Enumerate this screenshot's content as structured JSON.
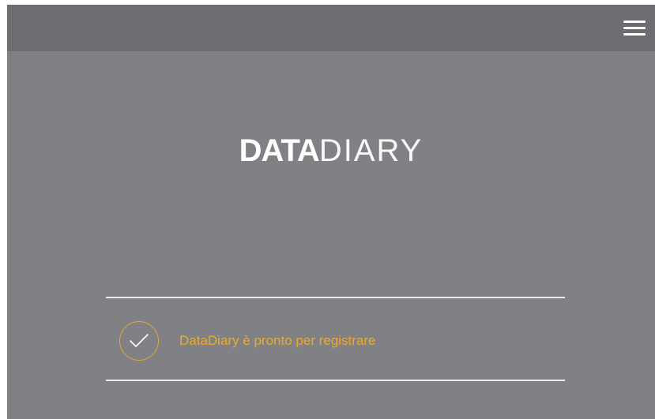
{
  "header": {
    "menu_icon": "hamburger-menu-icon"
  },
  "logo": {
    "bold": "DATA",
    "light": "DIARY"
  },
  "status": {
    "icon": "checkmark-circle-icon",
    "text": "DataDiary è pronto per registrare"
  },
  "colors": {
    "background": "#808184",
    "header": "#6c6d70",
    "accent": "#e7a831",
    "divider": "#e9e9ea"
  }
}
